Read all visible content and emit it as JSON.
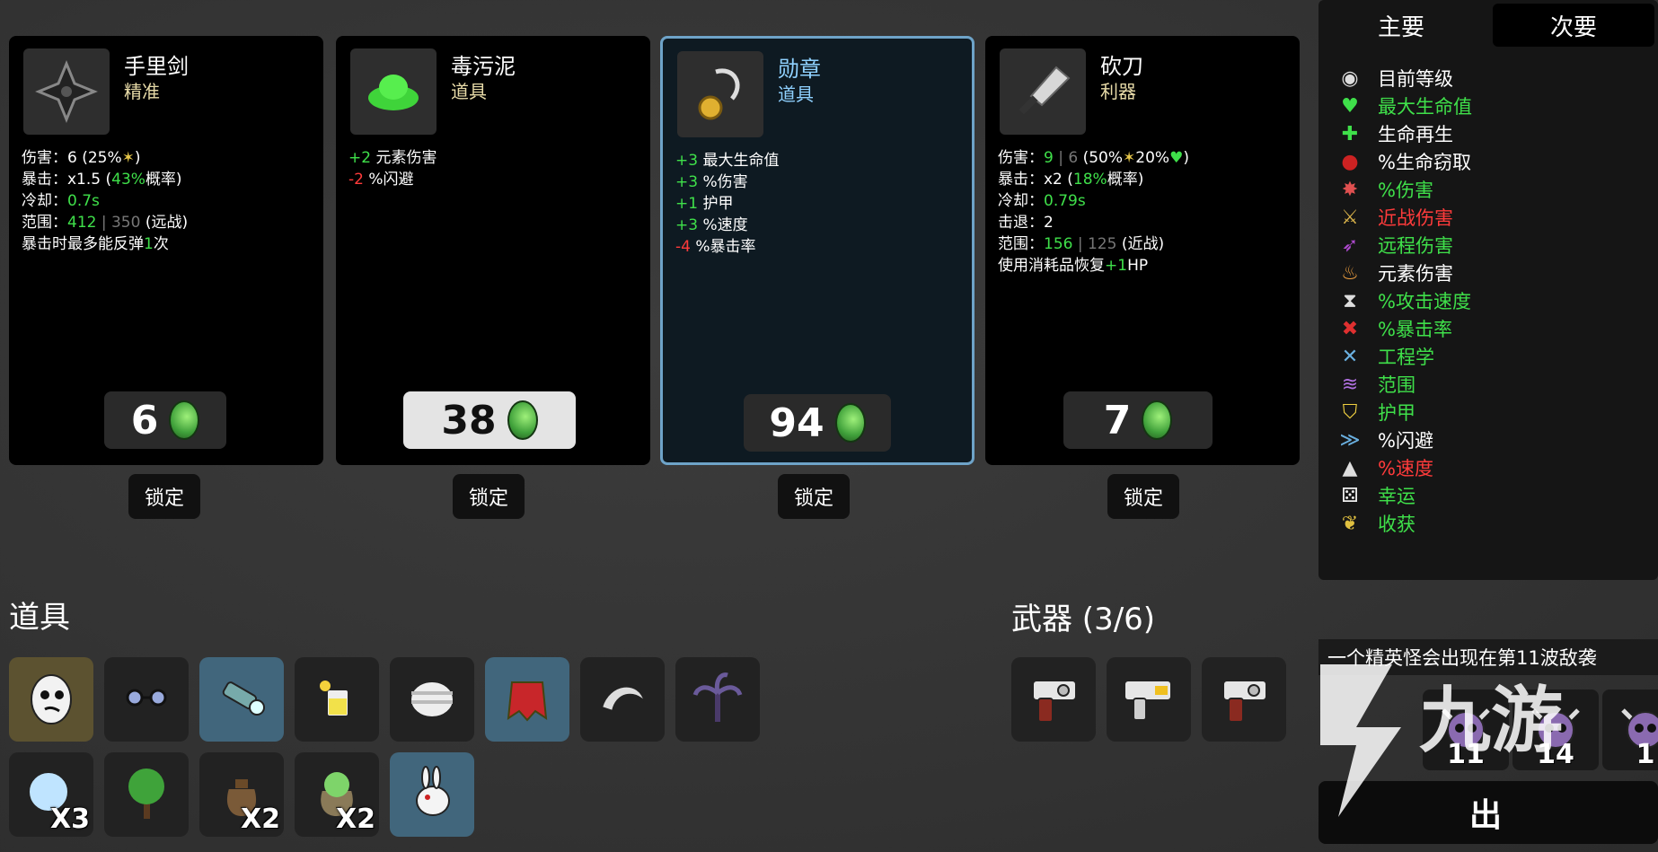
{
  "shop": {
    "items": [
      {
        "name": "手里剑",
        "tag": "精准",
        "price": "6",
        "lock": "锁定",
        "lines": [
          [
            {
              "t": "伤害：6 (25%"
            },
            {
              "t": "✶",
              "c": "y"
            },
            {
              "t": ")"
            }
          ],
          [
            {
              "t": "暴击：x1.5 ("
            },
            {
              "t": "43%",
              "c": "g"
            },
            {
              "t": "概率)"
            }
          ],
          [
            {
              "t": "冷却："
            },
            {
              "t": "0.7s",
              "c": "g"
            }
          ],
          [
            {
              "t": "范围："
            },
            {
              "t": "412",
              "c": "g"
            },
            {
              "t": " | 350",
              "c": "d"
            },
            {
              "t": " (远战)"
            }
          ],
          [
            {
              "t": "暴击时最多能反弹"
            },
            {
              "t": "1",
              "c": "g"
            },
            {
              "t": "次"
            }
          ]
        ]
      },
      {
        "name": "毒污泥",
        "tag": "道具",
        "price": "38",
        "lock": "锁定",
        "lines": [
          [
            {
              "t": "+2",
              "c": "g"
            },
            {
              "t": " 元素伤害"
            }
          ],
          [
            {
              "t": "-2",
              "c": "r"
            },
            {
              "t": " %闪避"
            }
          ]
        ]
      },
      {
        "name": "勋章",
        "tag": "道具",
        "price": "94",
        "lock": "锁定",
        "lines": [
          [
            {
              "t": "+3",
              "c": "g"
            },
            {
              "t": " 最大生命值"
            }
          ],
          [
            {
              "t": "+3",
              "c": "g"
            },
            {
              "t": " %伤害"
            }
          ],
          [
            {
              "t": "+1",
              "c": "g"
            },
            {
              "t": " 护甲"
            }
          ],
          [
            {
              "t": "+3",
              "c": "g"
            },
            {
              "t": " %速度"
            }
          ],
          [
            {
              "t": "-4",
              "c": "r"
            },
            {
              "t": " %暴击率"
            }
          ]
        ]
      },
      {
        "name": "砍刀",
        "tag": "利器",
        "price": "7",
        "lock": "锁定",
        "lines": [
          [
            {
              "t": "伤害："
            },
            {
              "t": "9",
              "c": "g"
            },
            {
              "t": " | 6",
              "c": "d"
            },
            {
              "t": " (50%"
            },
            {
              "t": "✶",
              "c": "y"
            },
            {
              "t": "20%"
            },
            {
              "t": "♥",
              "c": "g"
            },
            {
              "t": ")"
            }
          ],
          [
            {
              "t": "暴击：x2 ("
            },
            {
              "t": "18%",
              "c": "g"
            },
            {
              "t": "概率)"
            }
          ],
          [
            {
              "t": "冷却："
            },
            {
              "t": "0.79s",
              "c": "g"
            }
          ],
          [
            {
              "t": "击退：2"
            }
          ],
          [
            {
              "t": "范围："
            },
            {
              "t": "156",
              "c": "g"
            },
            {
              "t": " | 125",
              "c": "d"
            },
            {
              "t": " (近战)"
            }
          ],
          [
            {
              "t": "使用消耗品恢复"
            },
            {
              "t": "+1",
              "c": "g"
            },
            {
              "t": "HP"
            }
          ]
        ]
      }
    ]
  },
  "inventory": {
    "items_title": "道具",
    "weapons_title": "武器 (3/6)",
    "items": [
      {
        "icon": "egg-face-icon",
        "bg": "gold",
        "count": ""
      },
      {
        "icon": "glasses-icon",
        "bg": "",
        "count": ""
      },
      {
        "icon": "flashlight-icon",
        "bg": "blue",
        "count": ""
      },
      {
        "icon": "lemonade-icon",
        "bg": "",
        "count": ""
      },
      {
        "icon": "bandaged-head-icon",
        "bg": "",
        "count": ""
      },
      {
        "icon": "red-cape-icon",
        "bg": "blue",
        "count": ""
      },
      {
        "icon": "crescent-claw-icon",
        "bg": "",
        "count": ""
      },
      {
        "icon": "palm-tree-icon",
        "bg": "",
        "count": ""
      },
      {
        "icon": "snowball-icon",
        "bg": "",
        "count": "X3"
      },
      {
        "icon": "tree-icon",
        "bg": "",
        "count": ""
      },
      {
        "icon": "sack-icon",
        "bg": "",
        "count": "X2"
      },
      {
        "icon": "lettuce-sack-icon",
        "bg": "",
        "count": "X2"
      },
      {
        "icon": "rabbit-icon",
        "bg": "blue",
        "count": ""
      }
    ],
    "weapons": [
      {
        "icon": "revolver-icon"
      },
      {
        "icon": "laser-gun-icon"
      },
      {
        "icon": "revolver-icon"
      }
    ]
  },
  "stats_panel": {
    "tabs": [
      "主要",
      "次要"
    ],
    "active_tab": 1,
    "rows": [
      {
        "label": "目前等级",
        "value": "",
        "color": "#ffffff",
        "icon": "level-icon"
      },
      {
        "label": "最大生命值",
        "value": "",
        "color": "#3fe04a",
        "icon": "heart-icon"
      },
      {
        "label": "生命再生",
        "value": "",
        "color": "#ffffff",
        "icon": "regen-icon"
      },
      {
        "label": "%生命窃取",
        "value": "",
        "color": "#ffffff",
        "icon": "lifesteal-icon"
      },
      {
        "label": "%伤害",
        "value": "",
        "color": "#3fe04a",
        "icon": "damage-icon"
      },
      {
        "label": "近战伤害",
        "value": "",
        "color": "#ff3b3b",
        "icon": "melee-icon"
      },
      {
        "label": "远程伤害",
        "value": "",
        "color": "#3fe04a",
        "icon": "ranged-icon"
      },
      {
        "label": "元素伤害",
        "value": "",
        "color": "#ffffff",
        "icon": "elemental-icon"
      },
      {
        "label": "%攻击速度",
        "value": "",
        "color": "#3fe04a",
        "icon": "attack-speed-icon"
      },
      {
        "label": "%暴击率",
        "value": "",
        "color": "#3fe04a",
        "icon": "crit-icon"
      },
      {
        "label": "工程学",
        "value": "",
        "color": "#3fe04a",
        "icon": "engineering-icon"
      },
      {
        "label": "范围",
        "value": "",
        "color": "#3fe04a",
        "icon": "range-icon"
      },
      {
        "label": "护甲",
        "value": "",
        "color": "#3fe04a",
        "icon": "armor-icon"
      },
      {
        "label": "%闪避",
        "value": "",
        "color": "#ffffff",
        "icon": "dodge-icon"
      },
      {
        "label": "%速度",
        "value": "",
        "color": "#ff3b3b",
        "icon": "speed-icon"
      },
      {
        "label": "幸运",
        "value": "",
        "color": "#3fe04a",
        "icon": "luck-icon"
      },
      {
        "label": "收获",
        "value": "",
        "color": "#3fe04a",
        "icon": "harvest-icon"
      }
    ]
  },
  "wave": {
    "notice": "一个精英怪会出现在第11波敌袭",
    "enemies": [
      {
        "num": "11"
      },
      {
        "num": "14"
      },
      {
        "num": "1"
      }
    ],
    "go_label": "出"
  },
  "watermark": {
    "brand": "九游"
  },
  "colors": {
    "green": "#3fe04a",
    "red": "#ff3b3b",
    "highlight_border": "#6ea3c8",
    "coin": "#4fbf4a"
  }
}
